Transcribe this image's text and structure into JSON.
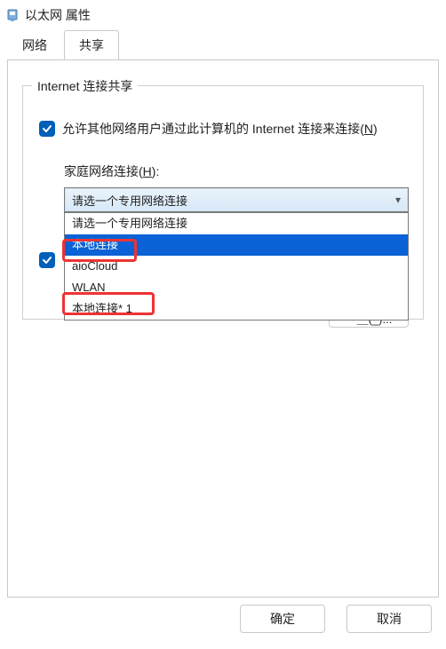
{
  "titlebar": {
    "title": "以太网 属性"
  },
  "tabs": {
    "network": "网络",
    "sharing": "共享"
  },
  "group": {
    "legend": "Internet 连接共享",
    "allow_label_prefix": "允许其他网络用户通过此计算机的 Internet 连接来连接(",
    "allow_label_mnemonic": "N",
    "allow_label_suffix": ")",
    "home_label_prefix": "家庭网络连接(",
    "home_label_mnemonic": "H",
    "home_label_suffix": "):",
    "combo_selected": "请选一个专用网络连接",
    "options": [
      "请选一个专用网络连接",
      "本地连接",
      "aioCloud",
      "WLAN",
      "本地连接* 1"
    ],
    "settings_cut": "～＿(_)..."
  },
  "footer": {
    "ok": "确定",
    "cancel": "取消"
  }
}
